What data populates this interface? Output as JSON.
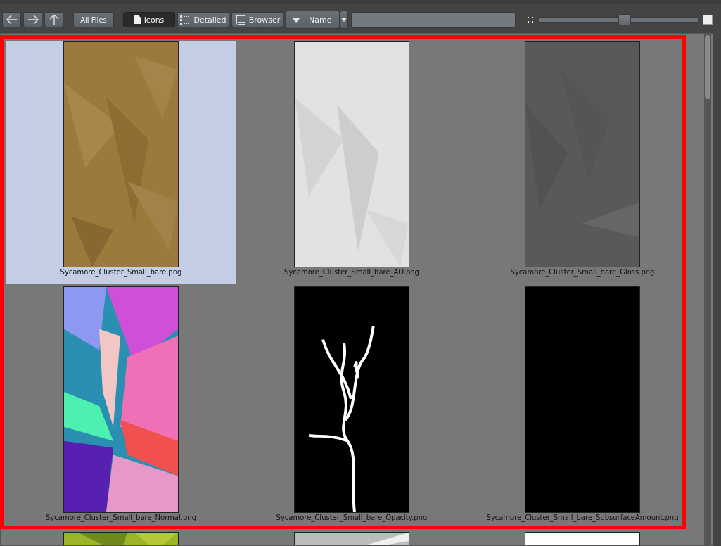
{
  "toolbar": {
    "nav": [
      {
        "kind": "back",
        "disabled": false
      },
      {
        "kind": "forward",
        "disabled": false
      },
      {
        "kind": "up",
        "disabled": false
      }
    ],
    "all_files": "All Files",
    "views": [
      {
        "kind": "icons",
        "label": "Icons",
        "selected": true
      },
      {
        "kind": "detailed",
        "label": "Detailed",
        "selected": false
      },
      {
        "kind": "browser",
        "label": "Browser",
        "selected": false
      }
    ],
    "sort": {
      "label": "Name"
    },
    "zoom": {
      "level": 0.54
    }
  },
  "files": [
    {
      "name": "Sycamore_Cluster_Small_bare.png",
      "kind": "bark",
      "selected": true
    },
    {
      "name": "Sycamore_Cluster_Small_bare_AO.png",
      "kind": "ao",
      "selected": false
    },
    {
      "name": "Sycamore_Cluster_Small_bare_Gloss.png",
      "kind": "gloss",
      "selected": false
    },
    {
      "name": "Sycamore_Cluster_Small_bare_Normal.png",
      "kind": "normal",
      "selected": false
    },
    {
      "name": "Sycamore_Cluster_Small_bare_Opacity.png",
      "kind": "opacity",
      "selected": false
    },
    {
      "name": "Sycamore_Cluster_Small_bare_SubsurfaceAmount.png",
      "kind": "black",
      "selected": false
    },
    {
      "kind": "leaves",
      "selected": false
    },
    {
      "kind": "light",
      "selected": false
    },
    {
      "kind": "white",
      "selected": false
    }
  ]
}
